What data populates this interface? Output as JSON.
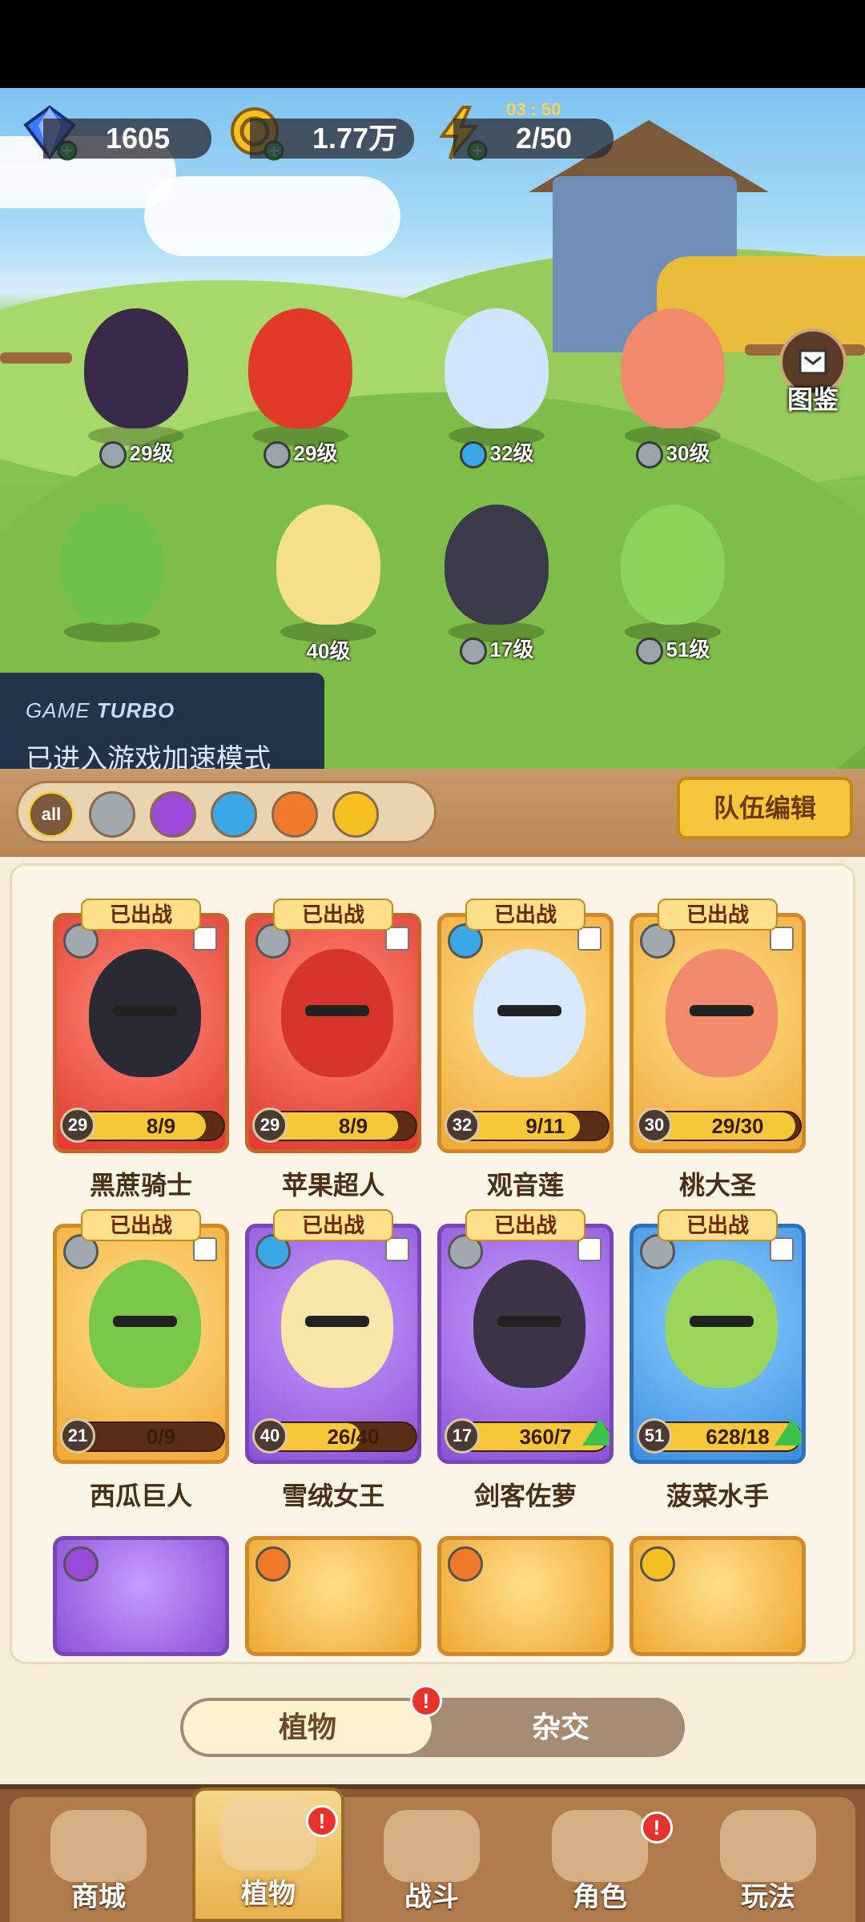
{
  "resources": {
    "gems": "1605",
    "coins": "1.77万",
    "energy": "2/50",
    "energy_timer": "03 : 50"
  },
  "codex_label": "图鉴",
  "lineup": [
    {
      "level": "29级",
      "element": "sword",
      "color": "#3a2a4a"
    },
    {
      "level": "29级",
      "element": "sword",
      "color": "#e23a2a"
    },
    {
      "level": "32级",
      "element": "water",
      "color": "#cfe4ff"
    },
    {
      "level": "30级",
      "element": "sword",
      "color": "#f08a6a"
    },
    {
      "level": "",
      "element": "",
      "color": "#6cc24a"
    },
    {
      "level": "40级",
      "element": "",
      "color": "#f5e08a"
    },
    {
      "level": "17级",
      "element": "sword",
      "color": "#3a3a4a"
    },
    {
      "level": "51级",
      "element": "sword",
      "color": "#8ad45a"
    }
  ],
  "turbo": {
    "title_a": "GAME ",
    "title_b": "TURBO",
    "message": "已进入游戏加速模式"
  },
  "filter_all": "all",
  "team_edit": "队伍编辑",
  "deployed_label": "已出战",
  "cards": [
    {
      "name": "黑蔗骑士",
      "level": "29",
      "progress": "8/9",
      "ratio": 0.89,
      "theme": "red",
      "art": "#2a2a36",
      "element": "sword"
    },
    {
      "name": "苹果超人",
      "level": "29",
      "progress": "8/9",
      "ratio": 0.89,
      "theme": "red",
      "art": "#d8352a",
      "element": "sword"
    },
    {
      "name": "观音莲",
      "level": "32",
      "progress": "9/11",
      "ratio": 0.82,
      "theme": "gold",
      "art": "#d7e8ff",
      "element": "water"
    },
    {
      "name": "桃大圣",
      "level": "30",
      "progress": "29/30",
      "ratio": 0.97,
      "theme": "gold",
      "art": "#f08a6a",
      "element": "sword"
    },
    {
      "name": "西瓜巨人",
      "level": "21",
      "progress": "0/9",
      "ratio": 0.0,
      "theme": "gold",
      "art": "#7ac84a",
      "element": "sword"
    },
    {
      "name": "雪绒女王",
      "level": "40",
      "progress": "26/40",
      "ratio": 0.65,
      "theme": "purple",
      "art": "#f7e6a6",
      "element": "water"
    },
    {
      "name": "剑客佐萝",
      "level": "17",
      "progress": "360/7",
      "ratio": 1.0,
      "theme": "purple",
      "art": "#3a3446",
      "element": "sword"
    },
    {
      "name": "菠菜水手",
      "level": "51",
      "progress": "628/18",
      "ratio": 1.0,
      "theme": "blue",
      "art": "#9ad65a",
      "element": "sword"
    }
  ],
  "tabs": {
    "plants": "植物",
    "hybrid": "杂交"
  },
  "badge": "!",
  "nav": [
    "商城",
    "植物",
    "战斗",
    "角色",
    "玩法"
  ]
}
